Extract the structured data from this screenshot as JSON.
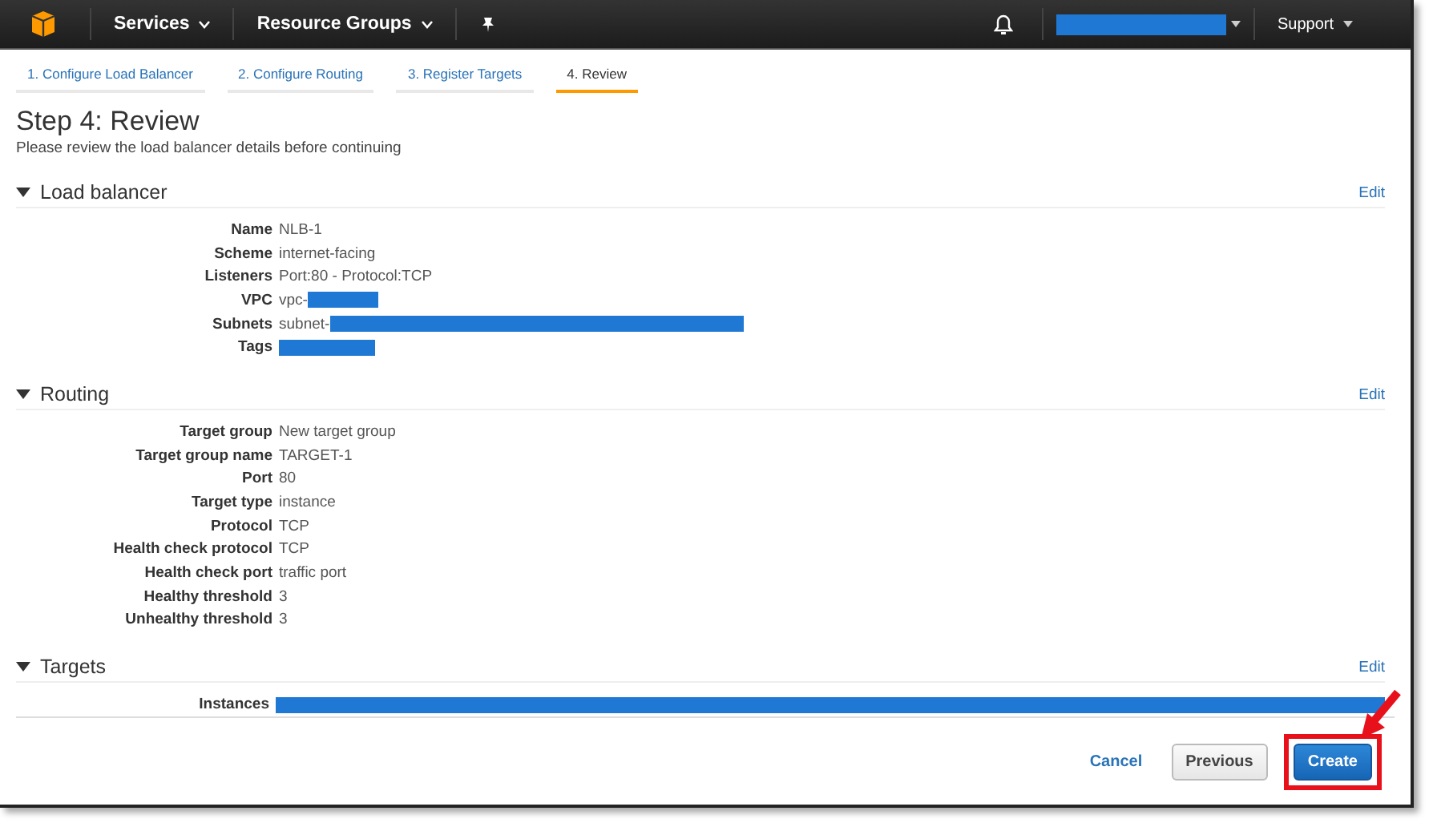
{
  "navbar": {
    "menus": [
      {
        "label": "Services",
        "caret": true
      },
      {
        "label": "Resource Groups",
        "caret": true
      }
    ],
    "account": {
      "redacted": true
    },
    "support": "Support"
  },
  "wizard_tabs": [
    {
      "label": "1. Configure Load Balancer",
      "selected": false
    },
    {
      "label": "2. Configure Routing",
      "selected": false
    },
    {
      "label": "3. Register Targets",
      "selected": false
    },
    {
      "label": "4. Review",
      "selected": true
    }
  ],
  "title": "Step 4: Review",
  "subtitle": "Please review the load balancer details before continuing",
  "sections": [
    {
      "title": "Load balancer",
      "edit": "Edit",
      "rows": [
        {
          "label": "Name",
          "value": "NLB-1",
          "redacted": false
        },
        {
          "label": "Scheme",
          "value": "internet-facing",
          "redacted": false
        },
        {
          "label": "Listeners",
          "value": "Port:80 - Protocol:TCP",
          "redacted": false
        },
        {
          "label": "VPC",
          "value": "vpc-",
          "redacted": true
        },
        {
          "label": "Subnets",
          "value": "subnet-",
          "redacted": true
        },
        {
          "label": "Tags",
          "redacted": true
        }
      ]
    },
    {
      "title": "Routing",
      "edit": "Edit",
      "rows": [
        {
          "label": "Target group",
          "value": "New target group",
          "redacted": false
        },
        {
          "label": "Target group name",
          "value": "TARGET-1",
          "redacted": false
        },
        {
          "label": "Port",
          "value": "80",
          "redacted": false
        },
        {
          "label": "Target type",
          "value": "instance",
          "redacted": false
        },
        {
          "label": "Protocol",
          "value": "TCP",
          "redacted": false
        },
        {
          "label": "Health check protocol",
          "value": "TCP",
          "redacted": false
        },
        {
          "label": "Health check port",
          "value": "traffic port",
          "redacted": false
        },
        {
          "label": "Healthy threshold",
          "value": "3",
          "redacted": false
        },
        {
          "label": "Unhealthy threshold",
          "value": "3",
          "redacted": false
        }
      ]
    },
    {
      "title": "Targets",
      "edit": "Edit",
      "rows": [
        {
          "label": "Instances",
          "redacted": true
        }
      ]
    }
  ],
  "footer": {
    "cancel": "Cancel",
    "previous": "Previous",
    "create": "Create",
    "create_highlighted": true
  }
}
